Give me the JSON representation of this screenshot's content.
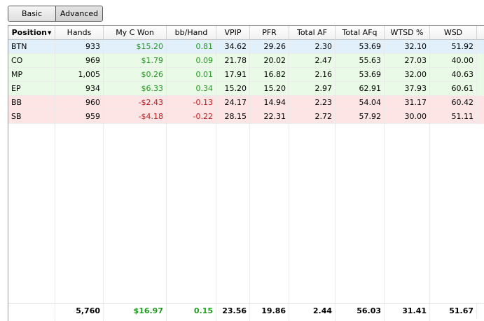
{
  "tabs": {
    "basic": "Basic",
    "advanced": "Advanced"
  },
  "columns": [
    "Position",
    "Hands",
    "My C Won",
    "bb/Hand",
    "VPIP",
    "PFR",
    "Total AF",
    "Total AFq",
    "WTSD %",
    "WSD"
  ],
  "rows": [
    {
      "position": "BTN",
      "hands": "933",
      "won": "$15.20",
      "bb": "0.81",
      "vpip": "34.62",
      "pfr": "29.26",
      "af": "2.30",
      "afq": "53.69",
      "wtsd": "32.10",
      "wsd": "51.92",
      "state": "sel"
    },
    {
      "position": "CO",
      "hands": "969",
      "won": "$1.79",
      "bb": "0.09",
      "vpip": "21.78",
      "pfr": "20.02",
      "af": "2.47",
      "afq": "55.63",
      "wtsd": "27.03",
      "wsd": "40.00",
      "state": "pos"
    },
    {
      "position": "MP",
      "hands": "1,005",
      "won": "$0.26",
      "bb": "0.01",
      "vpip": "17.91",
      "pfr": "16.82",
      "af": "2.16",
      "afq": "53.69",
      "wtsd": "32.00",
      "wsd": "40.63",
      "state": "pos"
    },
    {
      "position": "EP",
      "hands": "934",
      "won": "$6.33",
      "bb": "0.34",
      "vpip": "15.20",
      "pfr": "15.20",
      "af": "2.97",
      "afq": "62.91",
      "wtsd": "37.93",
      "wsd": "60.61",
      "state": "pos"
    },
    {
      "position": "BB",
      "hands": "960",
      "won": "-$2.43",
      "bb": "-0.13",
      "vpip": "24.17",
      "pfr": "14.94",
      "af": "2.23",
      "afq": "54.04",
      "wtsd": "31.17",
      "wsd": "60.42",
      "state": "neg"
    },
    {
      "position": "SB",
      "hands": "959",
      "won": "-$4.18",
      "bb": "-0.22",
      "vpip": "28.15",
      "pfr": "22.31",
      "af": "2.72",
      "afq": "57.92",
      "wtsd": "30.00",
      "wsd": "51.11",
      "state": "neg"
    }
  ],
  "totals": {
    "position": "",
    "hands": "5,760",
    "won": "$16.97",
    "bb": "0.15",
    "vpip": "23.56",
    "pfr": "19.86",
    "af": "2.44",
    "afq": "56.03",
    "wtsd": "31.41",
    "wsd": "51.67"
  },
  "colors": {
    "positive": "#1f9a1f",
    "negative": "#c21a1a",
    "selected_row": "#e2f0fb",
    "positive_row": "#e9fbe6",
    "negative_row": "#fde5e6"
  },
  "sort": {
    "column": "Position",
    "icon": "sort-descending-icon"
  }
}
